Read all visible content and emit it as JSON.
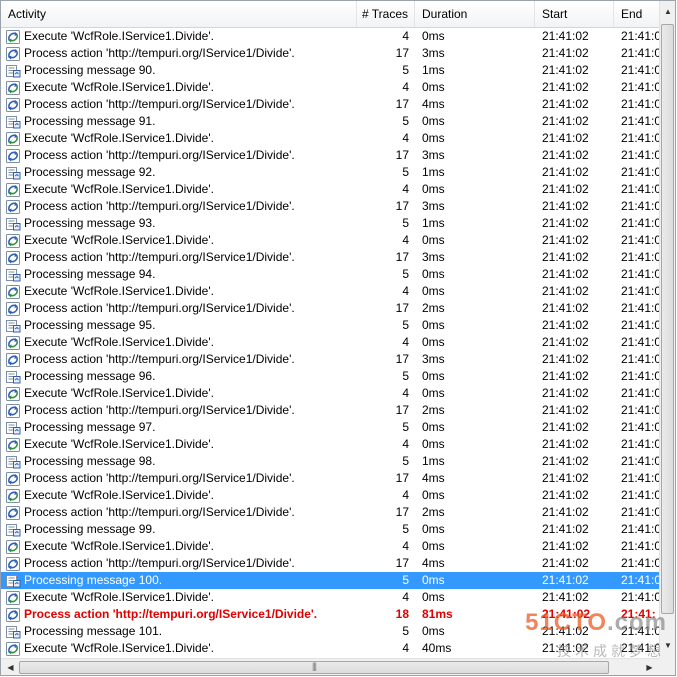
{
  "columns": {
    "activity": "Activity",
    "traces": "# Traces",
    "duration": "Duration",
    "start": "Start",
    "end": "End"
  },
  "rows": [
    {
      "icon": "execute-icon",
      "activity": "Execute 'WcfRole.IService1.Divide'.",
      "traces": "4",
      "duration": "0ms",
      "start": "21:41:02",
      "end": "21:41:0"
    },
    {
      "icon": "process-action-icon",
      "activity": "Process action 'http://tempuri.org/IService1/Divide'.",
      "traces": "17",
      "duration": "3ms",
      "start": "21:41:02",
      "end": "21:41:0"
    },
    {
      "icon": "message-icon",
      "activity": "Processing message 90.",
      "traces": "5",
      "duration": "1ms",
      "start": "21:41:02",
      "end": "21:41:0"
    },
    {
      "icon": "execute-icon",
      "activity": "Execute 'WcfRole.IService1.Divide'.",
      "traces": "4",
      "duration": "0ms",
      "start": "21:41:02",
      "end": "21:41:0"
    },
    {
      "icon": "process-action-icon",
      "activity": "Process action 'http://tempuri.org/IService1/Divide'.",
      "traces": "17",
      "duration": "4ms",
      "start": "21:41:02",
      "end": "21:41:0"
    },
    {
      "icon": "message-icon",
      "activity": "Processing message 91.",
      "traces": "5",
      "duration": "0ms",
      "start": "21:41:02",
      "end": "21:41:0"
    },
    {
      "icon": "execute-icon",
      "activity": "Execute 'WcfRole.IService1.Divide'.",
      "traces": "4",
      "duration": "0ms",
      "start": "21:41:02",
      "end": "21:41:0"
    },
    {
      "icon": "process-action-icon",
      "activity": "Process action 'http://tempuri.org/IService1/Divide'.",
      "traces": "17",
      "duration": "3ms",
      "start": "21:41:02",
      "end": "21:41:0"
    },
    {
      "icon": "message-icon",
      "activity": "Processing message 92.",
      "traces": "5",
      "duration": "1ms",
      "start": "21:41:02",
      "end": "21:41:0"
    },
    {
      "icon": "execute-icon",
      "activity": "Execute 'WcfRole.IService1.Divide'.",
      "traces": "4",
      "duration": "0ms",
      "start": "21:41:02",
      "end": "21:41:0"
    },
    {
      "icon": "process-action-icon",
      "activity": "Process action 'http://tempuri.org/IService1/Divide'.",
      "traces": "17",
      "duration": "3ms",
      "start": "21:41:02",
      "end": "21:41:0"
    },
    {
      "icon": "message-icon",
      "activity": "Processing message 93.",
      "traces": "5",
      "duration": "1ms",
      "start": "21:41:02",
      "end": "21:41:0"
    },
    {
      "icon": "execute-icon",
      "activity": "Execute 'WcfRole.IService1.Divide'.",
      "traces": "4",
      "duration": "0ms",
      "start": "21:41:02",
      "end": "21:41:0"
    },
    {
      "icon": "process-action-icon",
      "activity": "Process action 'http://tempuri.org/IService1/Divide'.",
      "traces": "17",
      "duration": "3ms",
      "start": "21:41:02",
      "end": "21:41:0"
    },
    {
      "icon": "message-icon",
      "activity": "Processing message 94.",
      "traces": "5",
      "duration": "0ms",
      "start": "21:41:02",
      "end": "21:41:0"
    },
    {
      "icon": "execute-icon",
      "activity": "Execute 'WcfRole.IService1.Divide'.",
      "traces": "4",
      "duration": "0ms",
      "start": "21:41:02",
      "end": "21:41:0"
    },
    {
      "icon": "process-action-icon",
      "activity": "Process action 'http://tempuri.org/IService1/Divide'.",
      "traces": "17",
      "duration": "2ms",
      "start": "21:41:02",
      "end": "21:41:0"
    },
    {
      "icon": "message-icon",
      "activity": "Processing message 95.",
      "traces": "5",
      "duration": "0ms",
      "start": "21:41:02",
      "end": "21:41:0"
    },
    {
      "icon": "execute-icon",
      "activity": "Execute 'WcfRole.IService1.Divide'.",
      "traces": "4",
      "duration": "0ms",
      "start": "21:41:02",
      "end": "21:41:0"
    },
    {
      "icon": "process-action-icon",
      "activity": "Process action 'http://tempuri.org/IService1/Divide'.",
      "traces": "17",
      "duration": "3ms",
      "start": "21:41:02",
      "end": "21:41:0"
    },
    {
      "icon": "message-icon",
      "activity": "Processing message 96.",
      "traces": "5",
      "duration": "0ms",
      "start": "21:41:02",
      "end": "21:41:0"
    },
    {
      "icon": "execute-icon",
      "activity": "Execute 'WcfRole.IService1.Divide'.",
      "traces": "4",
      "duration": "0ms",
      "start": "21:41:02",
      "end": "21:41:0"
    },
    {
      "icon": "process-action-icon",
      "activity": "Process action 'http://tempuri.org/IService1/Divide'.",
      "traces": "17",
      "duration": "2ms",
      "start": "21:41:02",
      "end": "21:41:0"
    },
    {
      "icon": "message-icon",
      "activity": "Processing message 97.",
      "traces": "5",
      "duration": "0ms",
      "start": "21:41:02",
      "end": "21:41:0"
    },
    {
      "icon": "execute-icon",
      "activity": "Execute 'WcfRole.IService1.Divide'.",
      "traces": "4",
      "duration": "0ms",
      "start": "21:41:02",
      "end": "21:41:0"
    },
    {
      "icon": "message-icon",
      "activity": "Processing message 98.",
      "traces": "5",
      "duration": "1ms",
      "start": "21:41:02",
      "end": "21:41:0"
    },
    {
      "icon": "process-action-icon",
      "activity": "Process action 'http://tempuri.org/IService1/Divide'.",
      "traces": "17",
      "duration": "4ms",
      "start": "21:41:02",
      "end": "21:41:0"
    },
    {
      "icon": "execute-icon",
      "activity": "Execute 'WcfRole.IService1.Divide'.",
      "traces": "4",
      "duration": "0ms",
      "start": "21:41:02",
      "end": "21:41:0"
    },
    {
      "icon": "process-action-icon",
      "activity": "Process action 'http://tempuri.org/IService1/Divide'.",
      "traces": "17",
      "duration": "2ms",
      "start": "21:41:02",
      "end": "21:41:0"
    },
    {
      "icon": "message-icon",
      "activity": "Processing message 99.",
      "traces": "5",
      "duration": "0ms",
      "start": "21:41:02",
      "end": "21:41:0"
    },
    {
      "icon": "execute-icon",
      "activity": "Execute 'WcfRole.IService1.Divide'.",
      "traces": "4",
      "duration": "0ms",
      "start": "21:41:02",
      "end": "21:41:0"
    },
    {
      "icon": "process-action-icon",
      "activity": "Process action 'http://tempuri.org/IService1/Divide'.",
      "traces": "17",
      "duration": "4ms",
      "start": "21:41:02",
      "end": "21:41:0"
    },
    {
      "icon": "message-icon",
      "activity": "Processing message 100.",
      "traces": "5",
      "duration": "0ms",
      "start": "21:41:02",
      "end": "21:41:0",
      "state": "selected"
    },
    {
      "icon": "execute-icon",
      "activity": "Execute 'WcfRole.IService1.Divide'.",
      "traces": "4",
      "duration": "0ms",
      "start": "21:41:02",
      "end": "21:41:0"
    },
    {
      "icon": "process-action-icon",
      "activity": "Process action 'http://tempuri.org/IService1/Divide'.",
      "traces": "18",
      "duration": "81ms",
      "start": "21:41:02",
      "end": "21:41:",
      "state": "error"
    },
    {
      "icon": "message-icon",
      "activity": "Processing message 101.",
      "traces": "5",
      "duration": "0ms",
      "start": "21:41:02",
      "end": "21:41:0"
    },
    {
      "icon": "execute-icon",
      "activity": "Execute 'WcfRole.IService1.Divide'.",
      "traces": "4",
      "duration": "40ms",
      "start": "21:41:02",
      "end": "21:41:0"
    }
  ],
  "watermark": {
    "logo_number": "51CTO",
    "logo_suffix": ".com",
    "tagline": "技术成就梦想"
  },
  "colors": {
    "selected_bg": "#3399ff",
    "error_text": "#e00000",
    "icon_blue": "#2f5fb3"
  }
}
